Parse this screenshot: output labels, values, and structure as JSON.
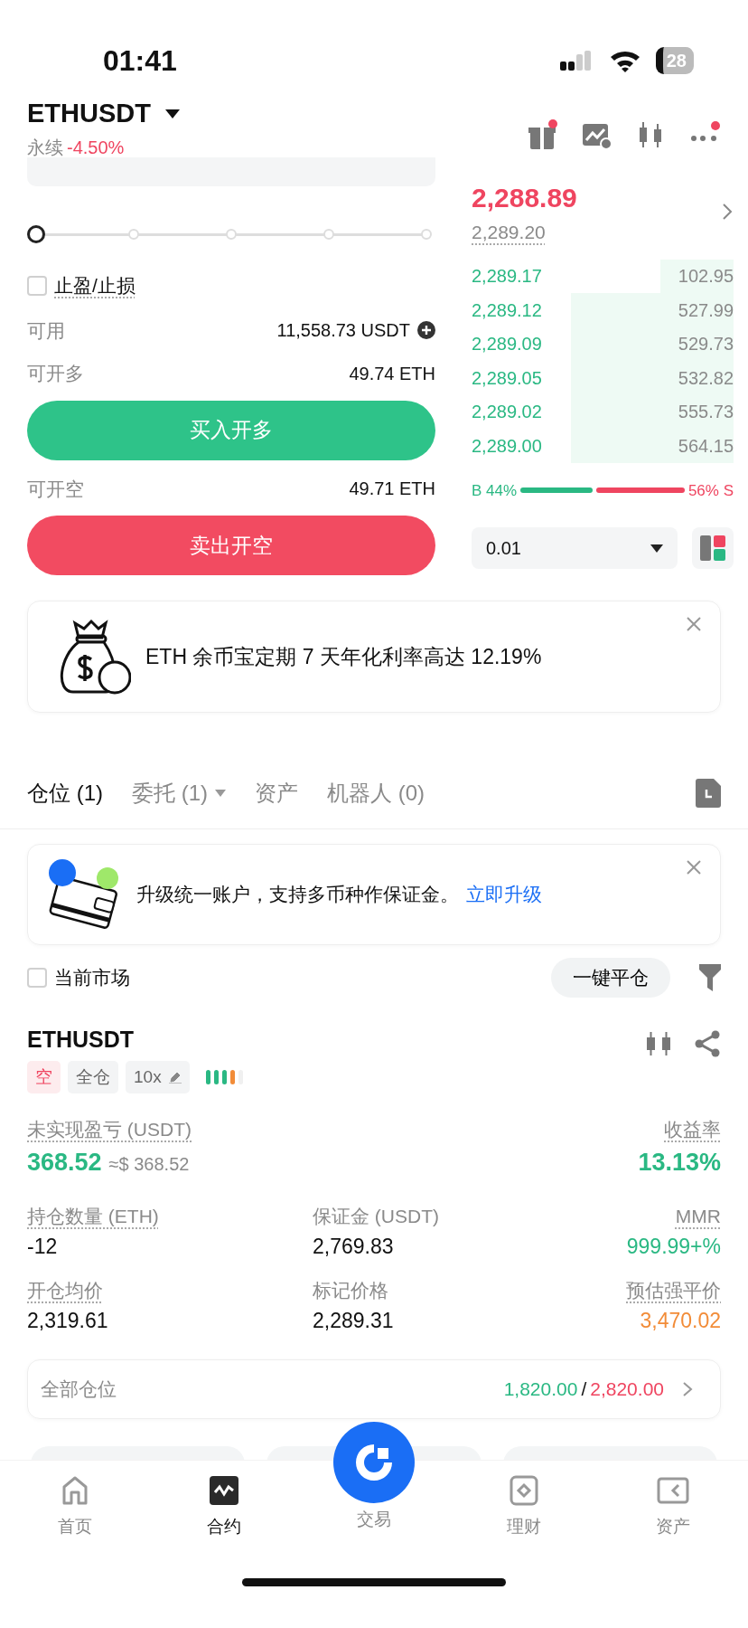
{
  "status_bar": {
    "time": "01:41",
    "battery": "28"
  },
  "header": {
    "symbol": "ETHUSDT",
    "type": "永续",
    "change": "-4.50%"
  },
  "order_form": {
    "slider": {
      "level": 0
    },
    "tpsl": {
      "label": "止盈/止损",
      "checked": false
    },
    "available": {
      "label": "可用",
      "value": "11,558.73 USDT"
    },
    "max_long": {
      "label": "可开多",
      "value": "49.74 ETH"
    },
    "buy_button": "买入开多",
    "max_short": {
      "label": "可开空",
      "value": "49.71 ETH"
    },
    "sell_button": "卖出开空"
  },
  "order_book": {
    "last_price": "2,288.89",
    "mark_price": "2,289.20",
    "bids": [
      {
        "price": "2,289.17",
        "size": "102.95"
      },
      {
        "price": "2,289.12",
        "size": "527.99"
      },
      {
        "price": "2,289.09",
        "size": "529.73"
      },
      {
        "price": "2,289.05",
        "size": "532.82"
      },
      {
        "price": "2,289.02",
        "size": "555.73"
      },
      {
        "price": "2,289.00",
        "size": "564.15"
      }
    ],
    "ratio": {
      "buy": "B 44%",
      "sell": "56% S"
    },
    "precision": "0.01"
  },
  "promo": {
    "text": "ETH 余币宝定期 7 天年化利率高达 12.19%"
  },
  "tabs": [
    {
      "label": "仓位 (1)",
      "selected": true,
      "dropdown": false
    },
    {
      "label": "委托 (1)",
      "selected": false,
      "dropdown": true
    },
    {
      "label": "资产",
      "selected": false,
      "dropdown": false
    },
    {
      "label": "机器人 (0)",
      "selected": false,
      "dropdown": false
    }
  ],
  "upgrade": {
    "text": "升级统一账户，支持多币种作保证金。",
    "link": "立即升级"
  },
  "filter": {
    "label": "当前市场",
    "checked": false,
    "close_all": "一键平仓"
  },
  "position": {
    "symbol": "ETHUSDT",
    "tags": [
      {
        "kind": "side",
        "label": "空"
      },
      {
        "kind": "margin",
        "label": "全仓"
      },
      {
        "kind": "leverage",
        "label": "10x"
      }
    ],
    "pnl": {
      "label": "未实现盈亏 (USDT)",
      "value": "368.52",
      "approx": "≈$ 368.52"
    },
    "roe": {
      "label": "收益率",
      "value": "13.13%"
    },
    "metrics": [
      {
        "label": "持仓数量 (ETH)",
        "value": "-12",
        "color": "#111111",
        "dotted": true
      },
      {
        "label": "保证金 (USDT)",
        "value": "2,769.83",
        "color": "#111111",
        "dotted": false
      },
      {
        "label": "MMR",
        "value": "999.99+%",
        "color": "#2ab883",
        "dotted": true
      },
      {
        "label": "开仓均价",
        "value": "2,319.61",
        "color": "#111111",
        "dotted": true
      },
      {
        "label": "标记价格",
        "value": "2,289.31",
        "color": "#111111",
        "dotted": false
      },
      {
        "label": "预估强平价",
        "value": "3,470.02",
        "color": "#f28c38",
        "dotted": true
      }
    ]
  },
  "summary": {
    "label": "全部仓位",
    "long": "1,820.00",
    "separator": "/",
    "short": "2,820.00"
  },
  "bottom_nav": [
    {
      "label": "首页",
      "selected": false
    },
    {
      "label": "合约",
      "selected": true
    },
    {
      "label": "交易",
      "selected": false
    },
    {
      "label": "理财",
      "selected": false
    },
    {
      "label": "资产",
      "selected": false
    }
  ]
}
